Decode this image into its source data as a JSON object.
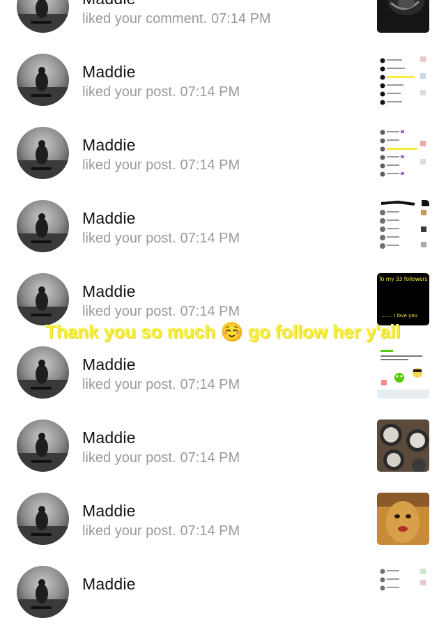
{
  "notifications": [
    {
      "user": "Maddie",
      "action": "liked your comment.",
      "time": "07:14 PM",
      "thumb": "dark-photo"
    },
    {
      "user": "Maddie",
      "action": "liked your post.",
      "time": "07:14 PM",
      "thumb": "list-screenshot"
    },
    {
      "user": "Maddie",
      "action": "liked your post.",
      "time": "07:14 PM",
      "thumb": "list-screenshot"
    },
    {
      "user": "Maddie",
      "action": "liked your post.",
      "time": "07:14 PM",
      "thumb": "list-screenshot-dark-header"
    },
    {
      "user": "Maddie",
      "action": "liked your post.",
      "time": "07:14 PM",
      "thumb": "black-text-card"
    },
    {
      "user": "Maddie",
      "action": "liked your post.",
      "time": "07:14 PM",
      "thumb": "duolingo-card"
    },
    {
      "user": "Maddie",
      "action": "liked your post.",
      "time": "07:14 PM",
      "thumb": "buttons-photo"
    },
    {
      "user": "Maddie",
      "action": "liked your post.",
      "time": "07:14 PM",
      "thumb": "nugget-photo"
    },
    {
      "user": "Maddie",
      "action": "",
      "time": "",
      "thumb": "list-screenshot"
    }
  ],
  "overlay_caption": "Thank you so much ☺️ go follow her y'all",
  "thumb_texts": {
    "card_top": "To my 33 followers",
    "card_bottom": "....... I love you"
  },
  "colors": {
    "caption_yellow": "#f4ec3e",
    "name_text": "#111111",
    "meta_text": "#9a9a9a"
  }
}
